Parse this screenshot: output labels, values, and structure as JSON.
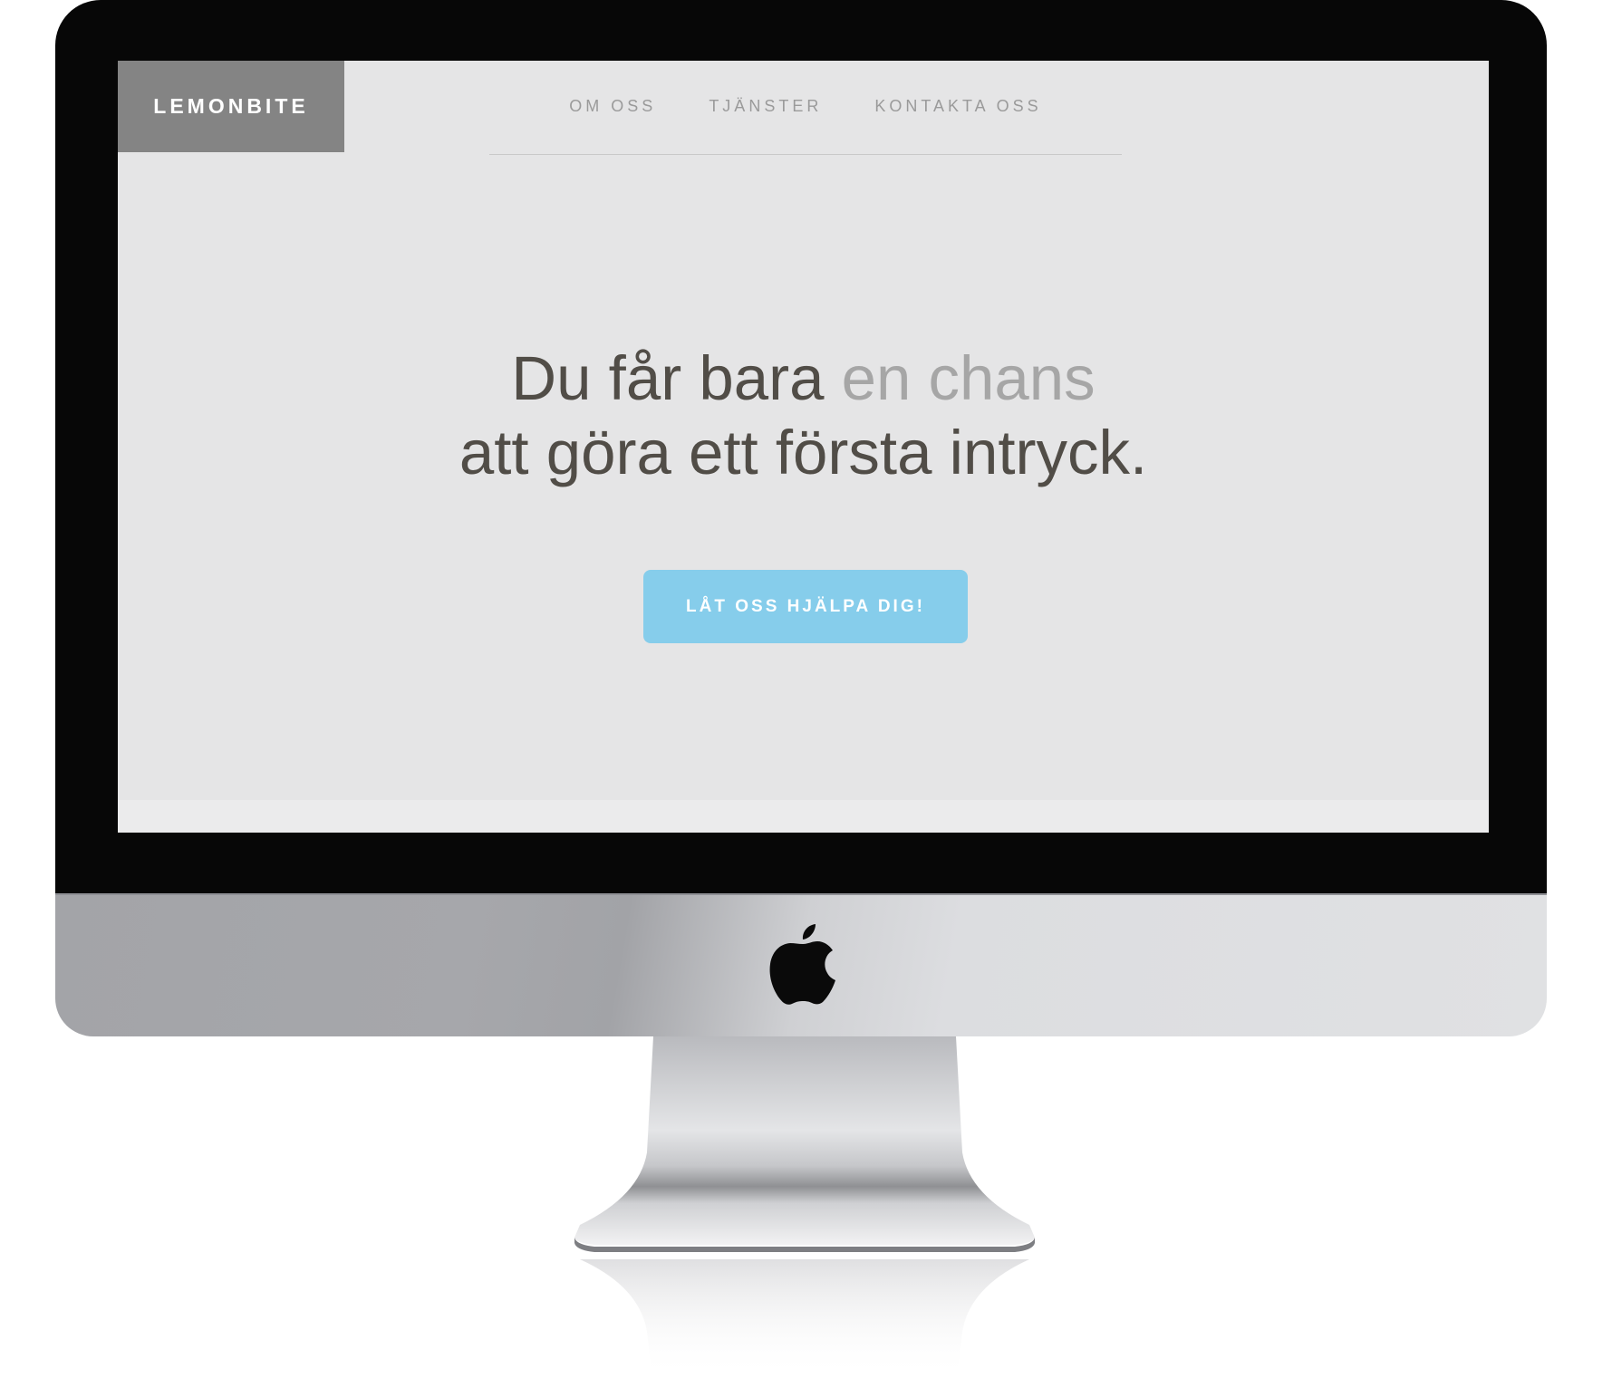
{
  "site": {
    "brand": "LEMONBITE",
    "nav": [
      {
        "label": "OM OSS"
      },
      {
        "label": "TJÄNSTER"
      },
      {
        "label": "KONTAKTA OSS"
      }
    ],
    "hero": {
      "line1_prefix": "Du får bara",
      "line1_accent": "en chans",
      "line2": "att göra ett första intryck."
    },
    "cta_label": "LÅT OSS HJÄLPA DIG!"
  },
  "colors": {
    "brand_bg": "#848484",
    "screen_bg": "#e5e5e6",
    "hero_text": "#514d47",
    "hero_accent": "#a6a6a6",
    "cta_bg": "#86cdeb",
    "nav_text": "#9a9a9a"
  },
  "icons": {
    "device_logo": "apple-icon"
  }
}
